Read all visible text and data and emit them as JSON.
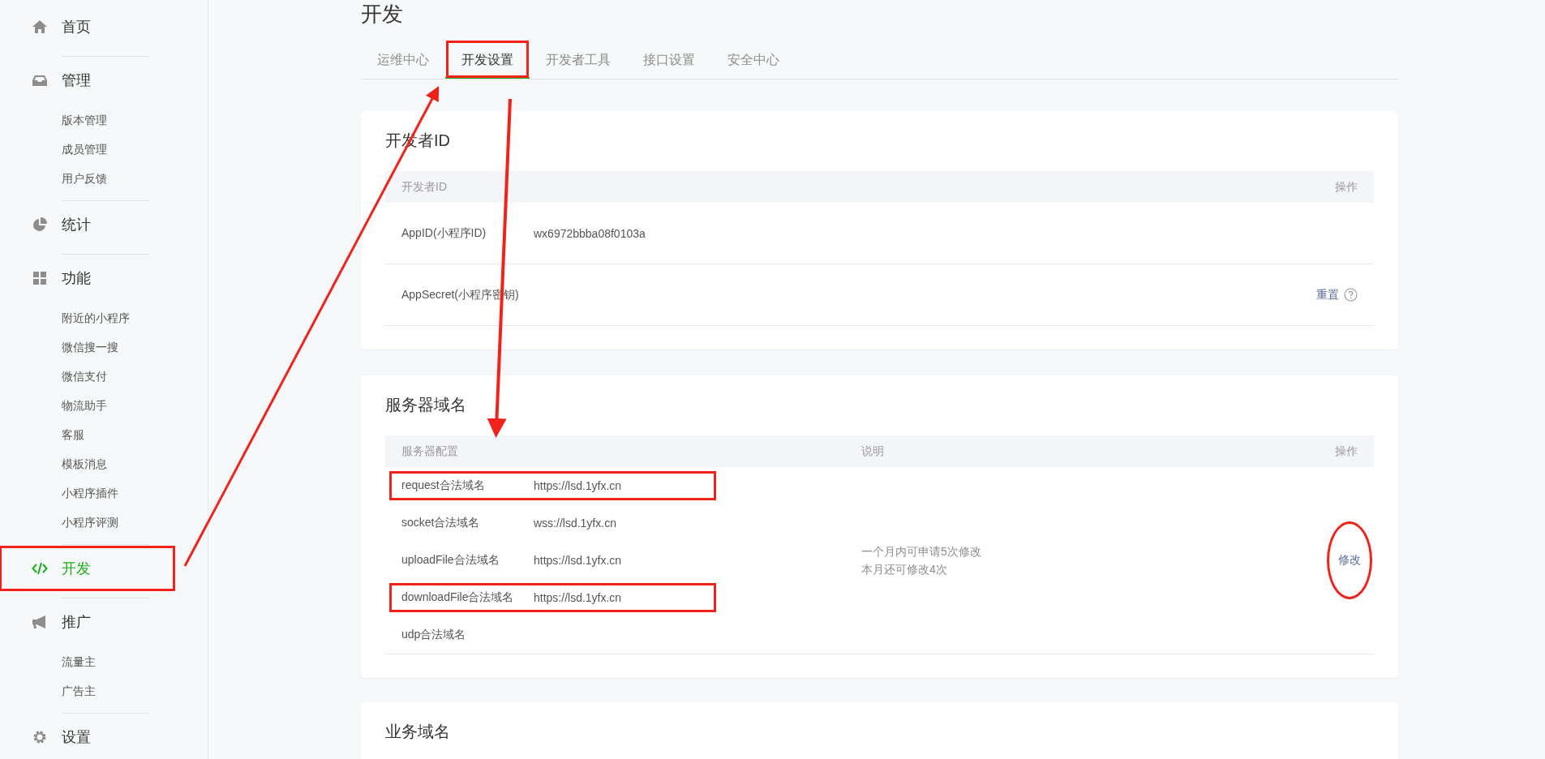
{
  "sidebar": {
    "groups": [
      {
        "label": "首页",
        "selected": false,
        "marked": false
      },
      {
        "label": "管理",
        "selected": false,
        "marked": false,
        "children": [
          {
            "label": "版本管理"
          },
          {
            "label": "成员管理"
          },
          {
            "label": "用户反馈"
          }
        ]
      },
      {
        "label": "统计",
        "selected": false,
        "marked": false
      },
      {
        "label": "功能",
        "selected": false,
        "marked": false,
        "children": [
          {
            "label": "附近的小程序"
          },
          {
            "label": "微信搜一搜"
          },
          {
            "label": "微信支付"
          },
          {
            "label": "物流助手"
          },
          {
            "label": "客服"
          },
          {
            "label": "模板消息"
          },
          {
            "label": "小程序插件"
          },
          {
            "label": "小程序评测"
          }
        ]
      },
      {
        "label": "开发",
        "selected": true,
        "marked": true
      },
      {
        "label": "推广",
        "selected": false,
        "marked": false,
        "children": [
          {
            "label": "流量主"
          },
          {
            "label": "广告主"
          }
        ]
      },
      {
        "label": "设置",
        "selected": false,
        "marked": false
      }
    ]
  },
  "page": {
    "title": "开发"
  },
  "tabs": [
    {
      "label": "运维中心",
      "selected": false,
      "marked": false
    },
    {
      "label": "开发设置",
      "selected": true,
      "marked": true
    },
    {
      "label": "开发者工具",
      "selected": false,
      "marked": false
    },
    {
      "label": "接口设置",
      "selected": false,
      "marked": false
    },
    {
      "label": "安全中心",
      "selected": false,
      "marked": false
    }
  ],
  "developer_id": {
    "title": "开发者ID",
    "columns": [
      "开发者ID",
      "操作"
    ],
    "rows": [
      {
        "label": "AppID(小程序ID)",
        "value": "wx6972bbba08f0103a"
      },
      {
        "label": "AppSecret(小程序密钥)",
        "action": "重置",
        "help": true
      }
    ]
  },
  "server_domains": {
    "title": "服务器域名",
    "columns": [
      "服务器配置",
      "说明",
      "操作"
    ],
    "rows": [
      {
        "name": "request合法域名",
        "value": "https://lsd.1yfx.cn",
        "marked": true
      },
      {
        "name": "socket合法域名",
        "value": "wss://lsd.1yfx.cn",
        "marked": false
      },
      {
        "name": "uploadFile合法域名",
        "value": "https://lsd.1yfx.cn",
        "marked": false
      },
      {
        "name": "downloadFile合法域名",
        "value": "https://lsd.1yfx.cn",
        "marked": true
      },
      {
        "name": "udp合法域名",
        "marked": false
      }
    ],
    "notes": [
      "一个月内可申请5次修改",
      "本月还可修改4次"
    ],
    "action": "修改",
    "action_circled": true
  },
  "business_domains": {
    "title": "业务域名"
  }
}
